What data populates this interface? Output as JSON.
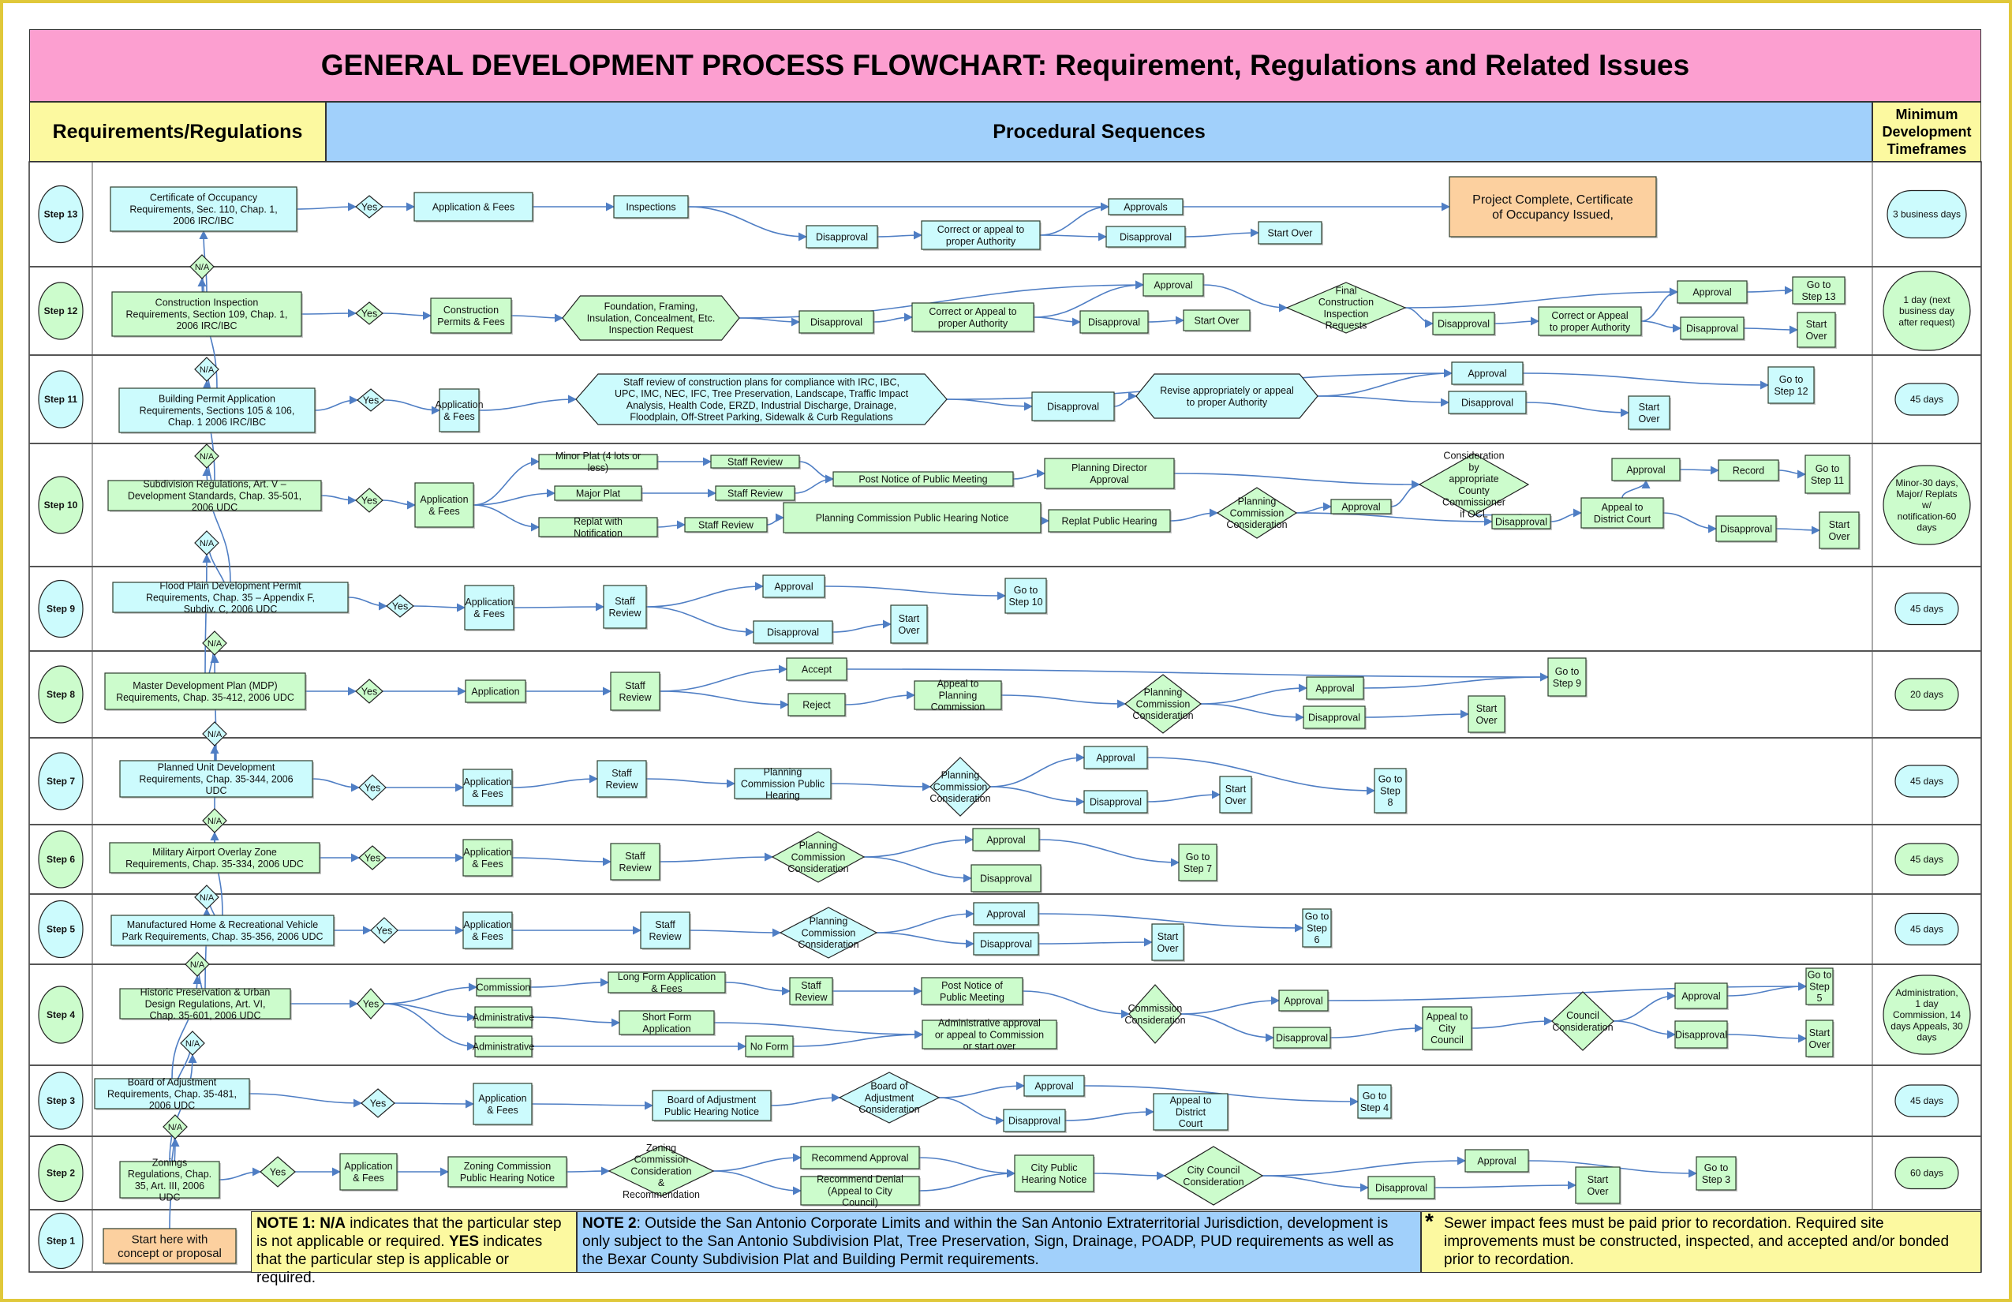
{
  "title": "GENERAL DEVELOPMENT PROCESS FLOWCHART:  Requirement, Regulations and Related Issues",
  "headers": {
    "requirements": "Requirements/Regulations",
    "procedural": "Procedural Sequences",
    "timeframes": "Minimum Development Timeframes"
  },
  "colors": {
    "title_band": "#fc9fd0",
    "yellow_header": "#fcf9a0",
    "blue_header": "#a1d0fb",
    "node_blue": "#ccfbfd",
    "node_green": "#ccfccc",
    "node_orange": "#fcd09f",
    "arrow": "#4f7ec4"
  },
  "steps": [
    {
      "label": "Step 13",
      "color": "blue",
      "timeframe": "3 business days",
      "requirement": "Certificate of Occupancy Requirements, Sec. 110, Chap. 1, 2006 IRC/IBC",
      "nodes": [
        "Yes",
        "Application & Fees",
        "Inspections",
        "Approvals",
        "Disapproval",
        "Correct or appeal to proper Authority",
        "Disapproval",
        "Start Over",
        "Project Complete, Certificate of Occupancy Issued,"
      ]
    },
    {
      "label": "Step 12",
      "color": "green",
      "timeframe": "1 day (next business day after request)",
      "requirement": "Construction Inspection Requirements, Section 109, Chap. 1, 2006 IRC/IBC",
      "nodes": [
        "Yes",
        "Construction Permits & Fees",
        "Foundation, Framing, Insulation, Concealment, Etc. Inspection Request",
        "Disapproval",
        "Correct or Appeal to proper Authority",
        "Approval",
        "Disapproval",
        "Start Over",
        "Final Construction Inspection Requests",
        "Disapproval",
        "Correct or Appeal to proper Authority",
        "Approval",
        "Go to Step 13",
        "Disapproval",
        "Start Over"
      ]
    },
    {
      "label": "Step 11",
      "color": "blue",
      "timeframe": "45 days",
      "requirement": "Building Permit Application Requirements, Sections 105 & 106, Chap. 1 2006 IRC/IBC",
      "nodes": [
        "Yes",
        "Application & Fees",
        "Staff review of construction plans for compliance with IRC, IBC, UPC, IMC, NEC, IFC, Tree Preservation, Landscape, Traffic Impact Analysis, Health Code, ERZD, Industrial Discharge, Drainage, Floodplain, Off-Street Parking, Sidewalk & Curb Regulations",
        "Disapproval",
        "Revise appropriately or appeal to proper Authority",
        "Approval",
        "Disapproval",
        "Start Over",
        "Go to Step 12"
      ]
    },
    {
      "label": "Step 10",
      "color": "green",
      "timeframe": "Minor-30 days, Major/ Replats w/ notification-60 days",
      "requirement": "Subdivision Regulations, Art. V – Development Standards, Chap. 35-501, 2006 UDC",
      "nodes": [
        "Yes",
        "Application & Fees",
        "Minor Plat (4 lots or less)",
        "Major Plat",
        "Replat with Notification",
        "Staff Review",
        "Staff Review",
        "Staff Review",
        "Post Notice of Public Meeting",
        "Planning Commission Public Hearing Notice",
        "Planning Director Approval",
        "Replat Public Hearing",
        "Planning Commission Consideration",
        "Approval",
        "Consideration by appropriate County Commissioner if OCL",
        "Disapproval",
        "Appeal to District Court",
        "Approval",
        "Record",
        "Go to Step 11",
        "Disapproval",
        "Start Over"
      ]
    },
    {
      "label": "Step 9",
      "color": "blue",
      "timeframe": "45 days",
      "requirement": "Flood Plain Development Permit Requirements, Chap. 35 – Appendix F, Subdiv. C, 2006 UDC",
      "nodes": [
        "Yes",
        "Application & Fees",
        "Staff Review",
        "Approval",
        "Disapproval",
        "Start Over",
        "Go to Step 10"
      ]
    },
    {
      "label": "Step 8",
      "color": "green",
      "timeframe": "20 days",
      "requirement": "Master Development Plan (MDP) Requirements, Chap. 35-412, 2006 UDC",
      "nodes": [
        "Yes",
        "Application",
        "Staff Review",
        "Accept",
        "Reject",
        "Appeal to Planning Commission",
        "Planning Commission Consideration",
        "Approval",
        "Disapproval",
        "Start Over",
        "Go to Step 9"
      ]
    },
    {
      "label": "Step 7",
      "color": "blue",
      "timeframe": "45 days",
      "requirement": "Planned Unit Development Requirements, Chap. 35-344, 2006 UDC",
      "nodes": [
        "Yes",
        "Application & Fees",
        "Staff Review",
        "Planning Commission Public Hearing",
        "Planning Commission Consideration",
        "Approval",
        "Disapproval",
        "Start Over",
        "Go to Step 8"
      ]
    },
    {
      "label": "Step 6",
      "color": "green",
      "timeframe": "45 days",
      "requirement": "Military Airport Overlay Zone Requirements, Chap. 35-334, 2006 UDC",
      "nodes": [
        "Yes",
        "Application & Fees",
        "Staff Review",
        "Planning Commission Consideration",
        "Approval",
        "Disapproval",
        "Go to Step 7"
      ]
    },
    {
      "label": "Step 5",
      "color": "blue",
      "timeframe": "45 days",
      "requirement": "Manufactured Home & Recreational Vehicle Park Requirements, Chap. 35-356, 2006 UDC",
      "nodes": [
        "Yes",
        "Application & Fees",
        "Staff Review",
        "Planning Commission Consideration",
        "Approval",
        "Disapproval",
        "Start Over",
        "Go to Step 6"
      ]
    },
    {
      "label": "Step 4",
      "color": "green",
      "timeframe": "Administration, 1 day Commission, 14 days Appeals, 30 days",
      "requirement": "Historic Preservation & Urban Design Regulations, Art. VI, Chap. 35-601, 2006 UDC",
      "nodes": [
        "Yes",
        "Commission",
        "Administrative",
        "Administrative",
        "Long Form Application & Fees",
        "Short Form Application",
        "No Form",
        "Staff Review",
        "Post Notice of Public Meeting",
        "Administrative approval or appeal to Commission or start over",
        "Commission Consideration",
        "Approval",
        "Disapproval",
        "Appeal to City Council",
        "Council Consideration",
        "Approval",
        "Disapproval",
        "Go to Step 5",
        "Start Over"
      ]
    },
    {
      "label": "Step 3",
      "color": "blue",
      "timeframe": "45 days",
      "requirement": "Board of Adjustment Requirements, Chap. 35-481, 2006 UDC",
      "nodes": [
        "Yes",
        "Application & Fees",
        "Board of Adjustment Public Hearing Notice",
        "Board of Adjustment Consideration",
        "Approval",
        "Disapproval",
        "Appeal to District Court",
        "Go to Step 4"
      ]
    },
    {
      "label": "Step 2",
      "color": "green",
      "timeframe": "60 days",
      "requirement": "Zonings Regulations, Chap. 35, Art. III, 2006 UDC",
      "nodes": [
        "Yes",
        "Application & Fees",
        "Zoning Commission Public Hearing Notice",
        "Zoning Commission Consideration & Recommendation",
        "Recommend Approval",
        "Recommend Denial (Appeal to City Council)",
        "City Public Hearing Notice",
        "City Council Consideration",
        "Approval",
        "Disapproval",
        "Start Over",
        "Go to Step 3"
      ]
    },
    {
      "label": "Step 1",
      "color": "blue",
      "timeframe": "",
      "requirement": "Start here with concept or proposal",
      "nodes": []
    }
  ],
  "na_label": "N/A",
  "notes": {
    "note1_label": "NOTE 1:",
    "note1_na": "N/A",
    "note1_text_a": " indicates that the particular step is not applicable or required.  ",
    "note1_yes": "YES",
    "note1_text_b": " indicates that the particular step is applicable or required.",
    "note2_label": "NOTE 2",
    "note2_text": ":  Outside the San Antonio Corporate Limits and within the San Antonio Extraterritorial Jurisdiction, development is only subject to the San Antonio Subdivision Plat, Tree Preservation, Sign, Drainage, POADP, PUD requirements as well as the Bexar County Subdivision Plat and Building Permit requirements.",
    "note3_star": "*",
    "note3_text": "Sewer impact fees must be paid prior to recordation.  Required site improvements must be constructed, inspected, and accepted and/or bonded prior to recordation."
  }
}
